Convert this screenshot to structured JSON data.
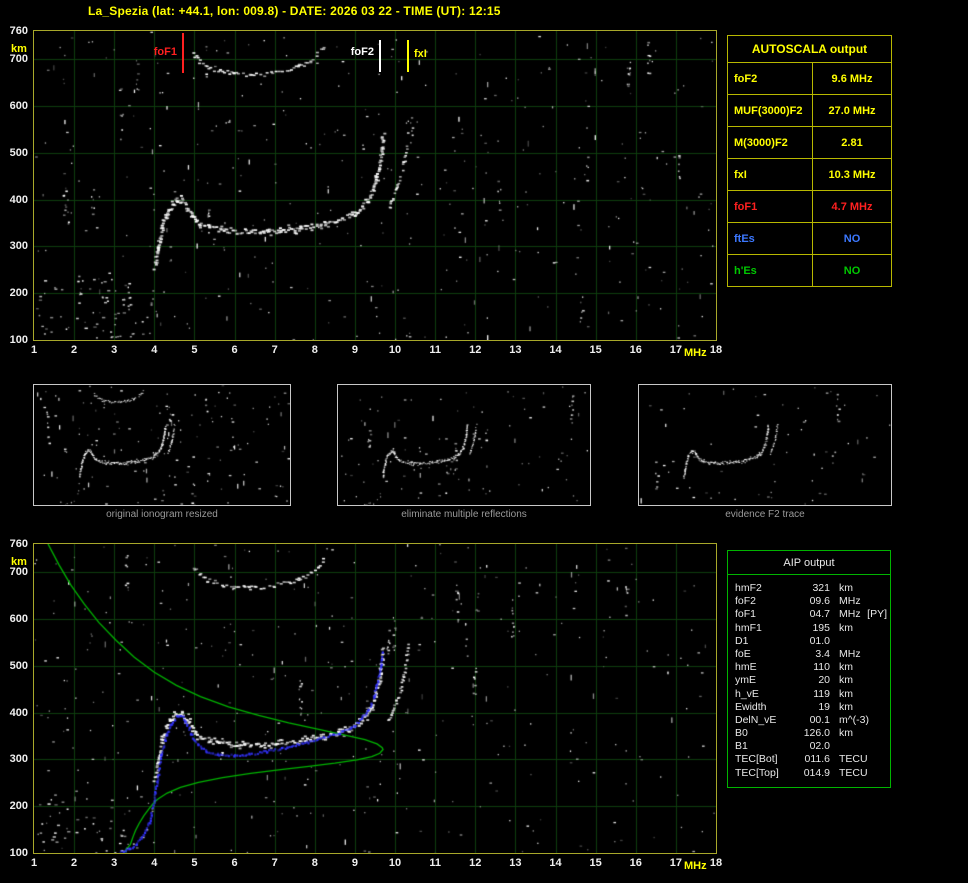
{
  "header": {
    "title": "La_Spezia (lat: +44.1, lon: 009.8) - DATE: 2026 03 22 - TIME (UT): 12:15"
  },
  "colors": {
    "accent": "#ffff00",
    "grid": "#0e3e0e",
    "echo_trace": "#ffffff",
    "profile_green": "#00b400",
    "autoscaled_blue": "#3333ff",
    "foF1_red": "#ff2020",
    "ftEs_blue": "#3c78ff",
    "hEs_green": "#00c800",
    "panel_border": "#a8a82a",
    "caption_gray": "#9a9a9a"
  },
  "autoscala_table": {
    "title": "AUTOSCALA output",
    "rows": [
      {
        "label": "foF2",
        "value": "9.6 MHz",
        "color": "#ffff00"
      },
      {
        "label": "MUF(3000)F2",
        "value": "27.0 MHz",
        "color": "#ffff00"
      },
      {
        "label": "M(3000)F2",
        "value": "2.81",
        "color": "#ffff00"
      },
      {
        "label": "fxI",
        "value": "10.3 MHz",
        "color": "#ffff00"
      },
      {
        "label": "foF1",
        "value": "4.7 MHz",
        "color": "#ff2020"
      },
      {
        "label": "ftEs",
        "value": "NO",
        "color": "#3c78ff"
      },
      {
        "label": "h'Es",
        "value": "NO",
        "color": "#00c800"
      }
    ]
  },
  "aip_table": {
    "title": "AIP output",
    "rows": [
      {
        "label": "hmF2",
        "value": "321",
        "unit": "km",
        "note": ""
      },
      {
        "label": "foF2",
        "value": "09.6",
        "unit": "MHz",
        "note": ""
      },
      {
        "label": "foF1",
        "value": "04.7",
        "unit": "MHz",
        "note": "[PY]"
      },
      {
        "label": "hmF1",
        "value": "195",
        "unit": "km",
        "note": ""
      },
      {
        "label": "D1",
        "value": "01.0",
        "unit": "",
        "note": ""
      },
      {
        "label": "foE",
        "value": "3.4",
        "unit": "MHz",
        "note": ""
      },
      {
        "label": "hmE",
        "value": "110",
        "unit": "km",
        "note": ""
      },
      {
        "label": "ymE",
        "value": "20",
        "unit": "km",
        "note": ""
      },
      {
        "label": "h_vE",
        "value": "119",
        "unit": "km",
        "note": ""
      },
      {
        "label": "Ewidth",
        "value": "19",
        "unit": "km",
        "note": ""
      },
      {
        "label": "DelN_vE",
        "value": "00.1",
        "unit": "m^(-3)",
        "note": ""
      },
      {
        "label": "B0",
        "value": "126.0",
        "unit": "km",
        "note": ""
      },
      {
        "label": "B1",
        "value": "02.0",
        "unit": "",
        "note": ""
      },
      {
        "label": "TEC[Bot]",
        "value": "011.6",
        "unit": "TECU",
        "note": ""
      },
      {
        "label": "TEC[Top]",
        "value": "014.9",
        "unit": "TECU",
        "note": ""
      }
    ]
  },
  "thumbnails": [
    {
      "caption": "original ionogram resized"
    },
    {
      "caption": "eliminate multiple reflections"
    },
    {
      "caption": "evidence F2 trace"
    }
  ],
  "chart_data": [
    {
      "type": "scatter",
      "name": "recorded-ionogram",
      "xlabel": "MHz",
      "ylabel": "km",
      "xlim": [
        1,
        18
      ],
      "ylim": [
        100,
        760
      ],
      "xticks": [
        1,
        2,
        3,
        4,
        5,
        6,
        7,
        8,
        9,
        10,
        11,
        12,
        13,
        14,
        15,
        16,
        17,
        18
      ],
      "yticks": [
        100,
        200,
        300,
        400,
        500,
        600,
        700,
        760
      ],
      "grid": true,
      "markers": [
        {
          "label": "foF1",
          "freq": 4.7,
          "color": "#ff2020",
          "side": "left",
          "tall": true
        },
        {
          "label": "foF2",
          "freq": 9.6,
          "color": "#ffffff",
          "side": "left",
          "tall": false
        },
        {
          "label": "fxI",
          "freq": 10.3,
          "color": "#ffff00",
          "side": "right",
          "tall": false
        }
      ],
      "series": [
        {
          "name": "F1-F2 o-mode echo trace",
          "color": "#ffffff",
          "render": {
            "w": 3,
            "h": 1.8,
            "step": 2,
            "jx": 1.2,
            "jy": 2.2,
            "prob": 0.88,
            "passes": 2
          },
          "points": [
            [
              3.98,
              255
            ],
            [
              4.08,
              300
            ],
            [
              4.18,
              345
            ],
            [
              4.3,
              372
            ],
            [
              4.42,
              388
            ],
            [
              4.55,
              398
            ],
            [
              4.65,
              400
            ],
            [
              4.78,
              386
            ],
            [
              4.92,
              366
            ],
            [
              5.1,
              350
            ],
            [
              5.35,
              341
            ],
            [
              5.7,
              335
            ],
            [
              6.1,
              332
            ],
            [
              6.6,
              332
            ],
            [
              7.1,
              335
            ],
            [
              7.6,
              340
            ],
            [
              8.1,
              348
            ],
            [
              8.5,
              356
            ],
            [
              8.9,
              368
            ],
            [
              9.1,
              380
            ],
            [
              9.28,
              396
            ],
            [
              9.4,
              416
            ],
            [
              9.5,
              442
            ],
            [
              9.58,
              472
            ],
            [
              9.64,
              505
            ],
            [
              9.68,
              540
            ]
          ]
        },
        {
          "name": "F2 x-mode echo trace",
          "color": "#ffffff",
          "render": {
            "w": 2.6,
            "h": 1.6,
            "step": 2.2,
            "jx": 1,
            "jy": 2,
            "prob": 0.8,
            "passes": 1
          },
          "points": [
            [
              9.82,
              382
            ],
            [
              9.92,
              402
            ],
            [
              10.02,
              425
            ],
            [
              10.12,
              452
            ],
            [
              10.2,
              482
            ],
            [
              10.26,
              512
            ],
            [
              10.3,
              545
            ]
          ]
        },
        {
          "name": "second order reflection",
          "color": "#ffffff",
          "render": {
            "w": 3,
            "h": 1.6,
            "step": 2.4,
            "jx": 1,
            "jy": 2.2,
            "prob": 0.78,
            "passes": 1
          },
          "points": [
            [
              4.95,
              712
            ],
            [
              5.1,
              697
            ],
            [
              5.3,
              685
            ],
            [
              5.6,
              676
            ],
            [
              5.95,
              670
            ],
            [
              6.35,
              668
            ],
            [
              6.75,
              670
            ],
            [
              7.15,
              676
            ],
            [
              7.55,
              685
            ],
            [
              7.85,
              697
            ],
            [
              8.05,
              712
            ],
            [
              8.2,
              726
            ]
          ]
        },
        {
          "name": "E region echoes",
          "color": "#ffffff",
          "render": {
            "w": 2,
            "h": 1.4,
            "step": 3.2,
            "jx": 1,
            "jy": 2.6,
            "prob": 0.42,
            "passes": 1
          },
          "points": [
            [
              2.55,
              101
            ],
            [
              2.85,
              103
            ],
            [
              3.15,
              107
            ],
            [
              3.45,
              116
            ],
            [
              3.65,
              130
            ],
            [
              3.82,
              152
            ],
            [
              3.93,
              185
            ],
            [
              4.0,
              225
            ]
          ]
        }
      ]
    },
    {
      "type": "scatter",
      "name": "ionogram-with-aip-profile",
      "xlabel": "MHz",
      "ylabel": "km",
      "xlim": [
        1,
        18
      ],
      "ylim": [
        100,
        760
      ],
      "xticks": [
        1,
        2,
        3,
        4,
        5,
        6,
        7,
        8,
        9,
        10,
        11,
        12,
        13,
        14,
        15,
        16,
        17,
        18
      ],
      "yticks": [
        100,
        200,
        300,
        400,
        500,
        600,
        700,
        760
      ],
      "grid": true,
      "includes_original_echoes": true,
      "markers": [],
      "series": [
        {
          "name": "electron density profile",
          "color": "#00b400",
          "style": "line",
          "points": [
            [
              1.35,
              760
            ],
            [
              1.62,
              716
            ],
            [
              1.92,
              672
            ],
            [
              2.25,
              632
            ],
            [
              2.62,
              592
            ],
            [
              3.05,
              554
            ],
            [
              3.5,
              518
            ],
            [
              4.0,
              486
            ],
            [
              4.55,
              458
            ],
            [
              5.15,
              434
            ],
            [
              5.85,
              412
            ],
            [
              6.6,
              394
            ],
            [
              7.35,
              378
            ],
            [
              8.1,
              364
            ],
            [
              8.75,
              352
            ],
            [
              9.25,
              342
            ],
            [
              9.55,
              333
            ],
            [
              9.68,
              325
            ],
            [
              9.7,
              321
            ],
            [
              9.62,
              313
            ],
            [
              9.42,
              306
            ],
            [
              9.05,
              299
            ],
            [
              8.5,
              292
            ],
            [
              7.85,
              285
            ],
            [
              7.15,
              278
            ],
            [
              6.4,
              270
            ],
            [
              5.7,
              261
            ],
            [
              5.1,
              251
            ],
            [
              4.65,
              240
            ],
            [
              4.32,
              228
            ],
            [
              4.1,
              216
            ],
            [
              3.96,
              205
            ],
            [
              3.87,
              195
            ],
            [
              3.74,
              180
            ],
            [
              3.62,
              163
            ],
            [
              3.53,
              148
            ],
            [
              3.47,
              135
            ],
            [
              3.43,
              125
            ],
            [
              3.4,
              118
            ],
            [
              3.35,
              113
            ],
            [
              3.3,
              109
            ],
            [
              3.28,
              105
            ],
            [
              3.3,
              101
            ]
          ]
        },
        {
          "name": "autoscaled trace",
          "color": "#3333ff",
          "render": {
            "w": 2.2,
            "h": 2.2,
            "step": 2,
            "jx": 0.8,
            "jy": 1.2,
            "prob": 0.95,
            "passes": 1
          },
          "points": [
            [
              3.1,
              103
            ],
            [
              3.35,
              110
            ],
            [
              3.55,
              122
            ],
            [
              3.72,
              140
            ],
            [
              3.86,
              168
            ],
            [
              3.96,
              205
            ],
            [
              4.05,
              255
            ],
            [
              4.15,
              310
            ],
            [
              4.28,
              352
            ],
            [
              4.42,
              378
            ],
            [
              4.55,
              392
            ],
            [
              4.65,
              396
            ],
            [
              4.76,
              382
            ],
            [
              4.9,
              356
            ],
            [
              5.05,
              334
            ],
            [
              5.25,
              320
            ],
            [
              5.55,
              313
            ],
            [
              5.95,
              310
            ],
            [
              6.35,
              313
            ],
            [
              6.8,
              319
            ],
            [
              7.3,
              328
            ],
            [
              7.8,
              338
            ],
            [
              8.2,
              348
            ],
            [
              8.6,
              358
            ],
            [
              8.95,
              372
            ],
            [
              9.15,
              388
            ],
            [
              9.32,
              408
            ],
            [
              9.45,
              435
            ],
            [
              9.55,
              468
            ],
            [
              9.62,
              502
            ],
            [
              9.66,
              532
            ]
          ]
        }
      ]
    }
  ]
}
